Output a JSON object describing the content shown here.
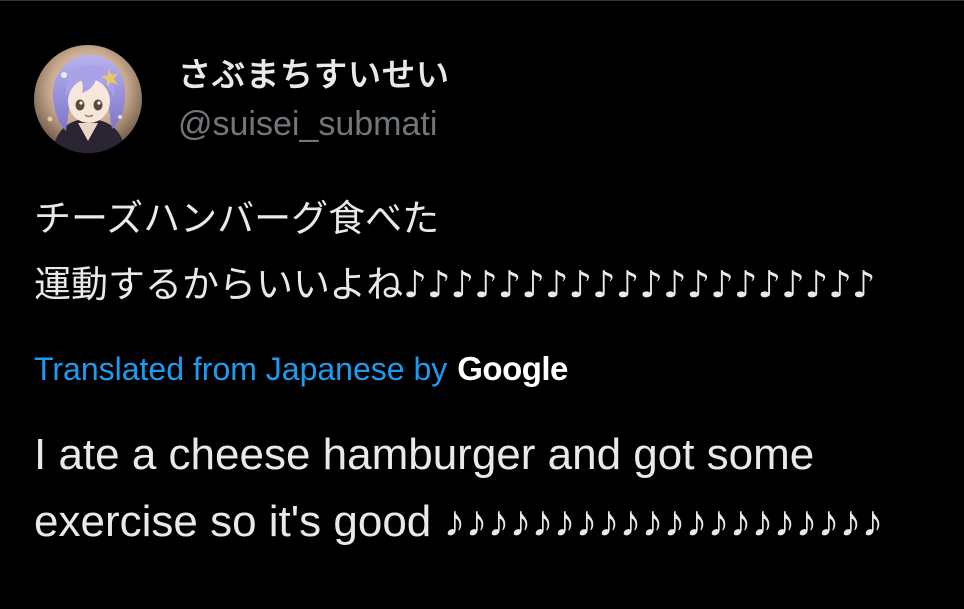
{
  "tweet": {
    "author": {
      "display_name": "さぶまちすいせい",
      "handle": "@suisei_submati",
      "avatar_icon": "avatar-anime-girl-icon"
    },
    "original_text": "チーズハンバーグ食べた\n運動するからいいよね♪♪♪♪♪♪♪♪♪♪♪♪♪♪♪♪♪♪♪♪",
    "translation": {
      "link_label": "Translated from Japanese by",
      "provider": "Google",
      "text": "I ate a cheese hamburger and got some exercise so it's good ♪♪♪♪♪♪♪♪♪♪♪♪♪♪♪♪♪♪♪♪"
    }
  },
  "colors": {
    "background": "#000000",
    "primary_text": "#e7e9ea",
    "secondary_text": "#71767b",
    "link": "#1d9bf0"
  }
}
